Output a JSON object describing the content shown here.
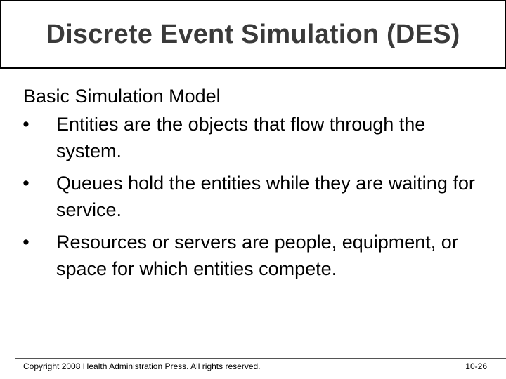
{
  "slide": {
    "title": "Discrete Event Simulation (DES)",
    "subtitle": "Basic Simulation Model",
    "bullet_glyph": "•",
    "bullets": [
      "Entities are the objects that flow through the system.",
      "Queues hold the entities while they are waiting for service.",
      "Resources or servers are people, equipment, or space for which entities compete."
    ]
  },
  "footer": {
    "copyright": "Copyright 2008 Health Administration Press. All rights reserved.",
    "page_number": "10-26"
  },
  "colors": {
    "title_text": "#3a3a3a",
    "border": "#000000",
    "background": "#ffffff"
  }
}
